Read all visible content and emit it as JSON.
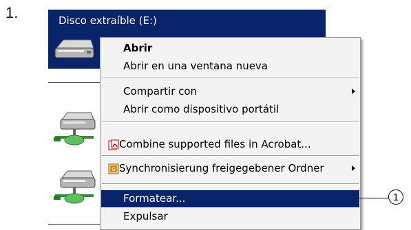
{
  "step": {
    "number": "1."
  },
  "explorer": {
    "selected_drive": {
      "name": "Disco extraíble (E:)",
      "icon": "removable-drive-icon"
    },
    "network_drives": [
      {
        "icon": "network-drive-icon"
      },
      {
        "icon": "network-drive-icon"
      }
    ],
    "selection_color": "#0a246a"
  },
  "context_menu": {
    "items": [
      {
        "label": "Abrir",
        "bold": true
      },
      {
        "label": "Abrir en una ventana nueva"
      },
      {
        "label": "Compartir con",
        "submenu": true
      },
      {
        "label": "Abrir como dispositivo portátil"
      },
      {
        "label": "Combine supported files in Acrobat...",
        "icon": "acrobat-icon"
      },
      {
        "label": "Synchronisierung freigegebener Ordner",
        "icon": "sync-icon",
        "submenu": true
      },
      {
        "label": "Formatear...",
        "highlighted": true
      },
      {
        "label": "Expulsar"
      }
    ],
    "highlight_color": "#0a246a"
  },
  "callout": {
    "label": "1"
  }
}
